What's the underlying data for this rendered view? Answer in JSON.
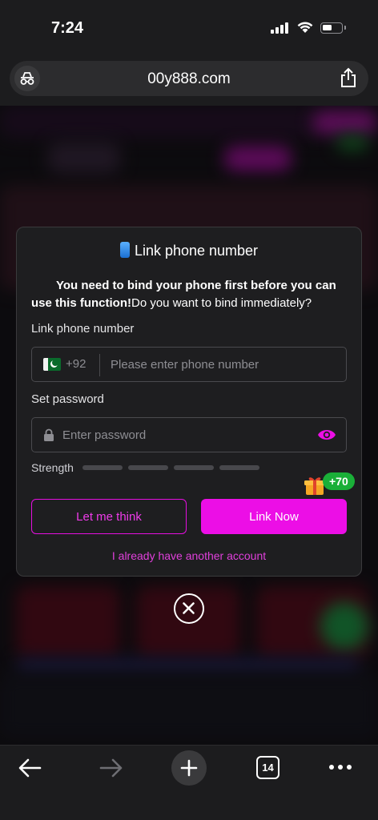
{
  "status_bar": {
    "time": "7:24"
  },
  "browser": {
    "url": "00y888.com",
    "open_tabs": "14"
  },
  "dialog": {
    "title": "Link phone number",
    "message_bold": "You need to bind your phone first before you can use this function!",
    "message_rest": "Do you want to bind immediately?",
    "phone_label": "Link phone number",
    "country_code": "+92",
    "phone_placeholder": "Please enter phone number",
    "password_label": "Set password",
    "password_placeholder": "Enter password",
    "strength_label": "Strength",
    "think_button": "Let me think",
    "link_button": "Link Now",
    "bonus_badge": "+70",
    "alt_account_link": "I already have another account"
  },
  "colors": {
    "accent_magenta": "#ec0ee6",
    "bonus_green": "#1aaf38",
    "dialog_bg": "#1e1e20"
  },
  "icons": {
    "incognito": "incognito-icon",
    "share": "share-icon",
    "lock": "lock-icon",
    "eye": "eye-icon",
    "gift": "gift-icon",
    "close": "close-icon",
    "back": "back-arrow-icon",
    "forward": "forward-arrow-icon",
    "new_tab": "plus-icon",
    "more": "more-dots-icon"
  }
}
